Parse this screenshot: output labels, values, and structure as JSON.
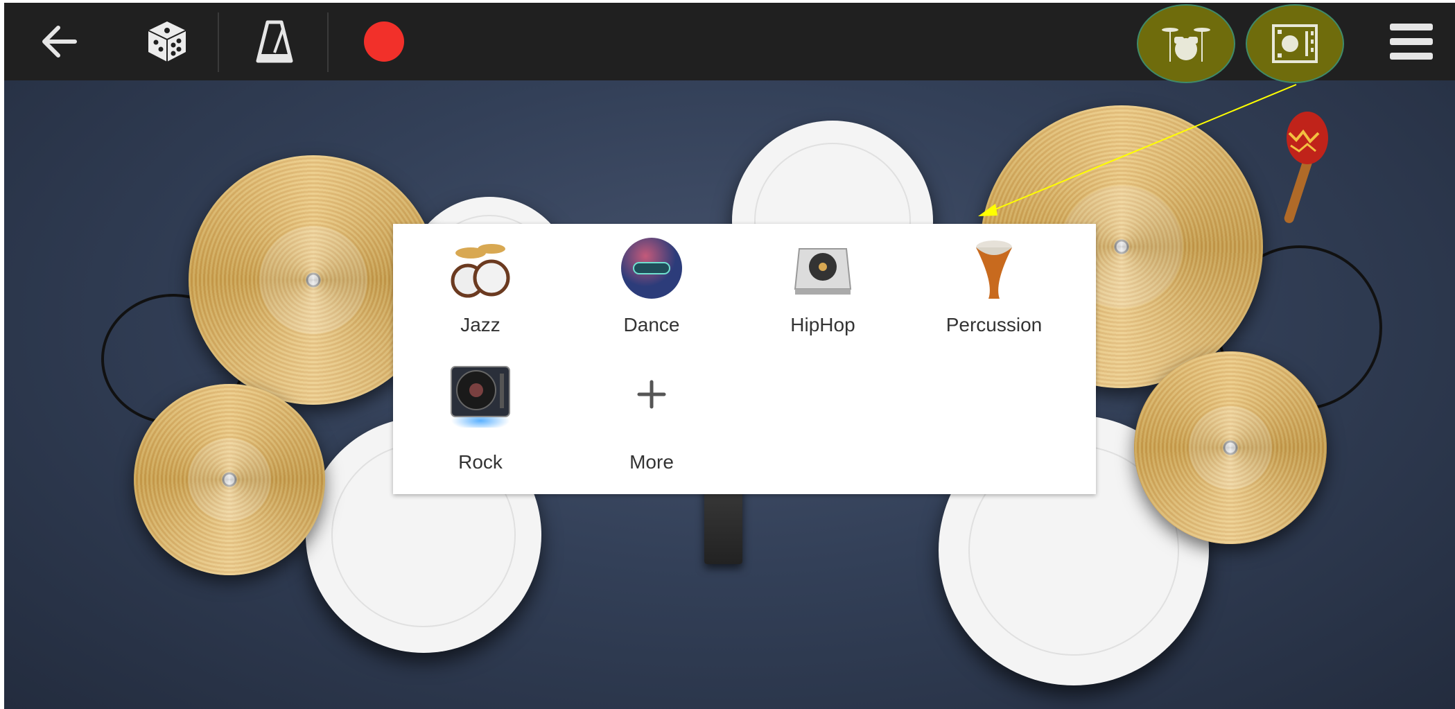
{
  "toolbar": {
    "icons": [
      "back-arrow-icon",
      "dice-icon",
      "metronome-icon",
      "record-icon",
      "drum-kit-icon",
      "kit-selector-icon",
      "hamburger-menu-icon"
    ],
    "record_color": "#f2302a",
    "highlight_color": "#6f6c0c"
  },
  "kit_menu": {
    "items": [
      {
        "label": "Jazz",
        "icon": "jazz-kit-icon"
      },
      {
        "label": "Dance",
        "icon": "dance-kit-icon"
      },
      {
        "label": "HipHop",
        "icon": "hiphop-kit-icon"
      },
      {
        "label": "Percussion",
        "icon": "percussion-kit-icon"
      },
      {
        "label": "Rock",
        "icon": "rock-kit-icon",
        "selected": true
      },
      {
        "label": "More",
        "icon": "plus-icon"
      }
    ]
  },
  "annotation": {
    "arrow_color": "#ffff00"
  }
}
